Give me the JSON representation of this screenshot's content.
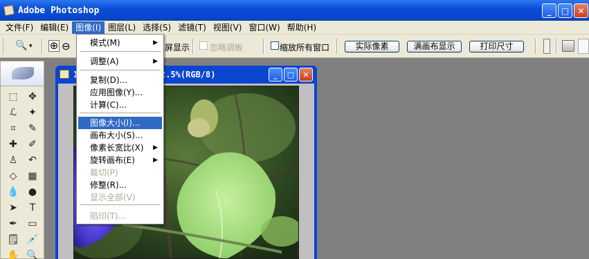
{
  "window": {
    "title": "Adobe Photoshop",
    "controls": {
      "minimize": "_",
      "maximize": "□",
      "close": "✕"
    }
  },
  "menubar": {
    "items": [
      "文件(F)",
      "编辑(E)",
      "图像(I)",
      "图层(L)",
      "选择(S)",
      "滤镜(T)",
      "视图(V)",
      "窗口(W)",
      "帮助(H)"
    ],
    "active_index": 2
  },
  "options_bar": {
    "tool_icon": "zoom-icon",
    "tool_glyph": "🔍",
    "caret": "▾",
    "zoom_in_glyph": "⊕",
    "zoom_out_glyph": "⊖",
    "fit_screen_label": "屏显示",
    "ignore_palettes_label": "忽略调板",
    "zoom_all_windows_label": "缩放所有窗口",
    "actual_pixels_label": "实际像素",
    "fit_on_screen_label": "满画布显示",
    "print_size_label": "打印尺寸"
  },
  "document": {
    "title_suffix": "2.5%(RGB/8)",
    "title_prefix": "1"
  },
  "image_menu": {
    "items": [
      {
        "label": "模式(M)",
        "submenu": true,
        "enabled": true
      },
      {
        "label": "调整(A)",
        "submenu": true,
        "enabled": true
      },
      {
        "label": "复制(D)...",
        "submenu": false,
        "enabled": true
      },
      {
        "label": "应用图像(Y)...",
        "submenu": false,
        "enabled": true
      },
      {
        "label": "计算(C)...",
        "submenu": false,
        "enabled": true
      },
      {
        "label": "图像大小(I)...",
        "submenu": false,
        "enabled": true,
        "highlighted": true
      },
      {
        "label": "画布大小(S)...",
        "submenu": false,
        "enabled": true
      },
      {
        "label": "像素长宽比(X)",
        "submenu": true,
        "enabled": true
      },
      {
        "label": "旋转画布(E)",
        "submenu": true,
        "enabled": true
      },
      {
        "label": "裁切(P)",
        "submenu": false,
        "enabled": false
      },
      {
        "label": "修整(R)...",
        "submenu": false,
        "enabled": true
      },
      {
        "label": "显示全部(V)",
        "submenu": false,
        "enabled": false
      },
      {
        "label": "陷印(T)...",
        "submenu": false,
        "enabled": false
      }
    ],
    "submenu_arrow": "▶"
  },
  "toolbox": {
    "tools": [
      {
        "name": "marquee-tool-icon",
        "glyph": "⬚"
      },
      {
        "name": "move-tool-icon",
        "glyph": "✥"
      },
      {
        "name": "lasso-tool-icon",
        "glyph": "ℒ"
      },
      {
        "name": "magic-wand-tool-icon",
        "glyph": "✦"
      },
      {
        "name": "crop-tool-icon",
        "glyph": "⌗"
      },
      {
        "name": "slice-tool-icon",
        "glyph": "✎"
      },
      {
        "name": "healing-brush-tool-icon",
        "glyph": "✚"
      },
      {
        "name": "brush-tool-icon",
        "glyph": "✐"
      },
      {
        "name": "clone-stamp-tool-icon",
        "glyph": "♙"
      },
      {
        "name": "history-brush-tool-icon",
        "glyph": "↶"
      },
      {
        "name": "eraser-tool-icon",
        "glyph": "◇"
      },
      {
        "name": "gradient-tool-icon",
        "glyph": "▦"
      },
      {
        "name": "blur-tool-icon",
        "glyph": "💧"
      },
      {
        "name": "dodge-tool-icon",
        "glyph": "●"
      },
      {
        "name": "path-selection-tool-icon",
        "glyph": "➤"
      },
      {
        "name": "type-tool-icon",
        "glyph": "T"
      },
      {
        "name": "pen-tool-icon",
        "glyph": "✒"
      },
      {
        "name": "shape-tool-icon",
        "glyph": "▭"
      },
      {
        "name": "notes-tool-icon",
        "glyph": "🗒"
      },
      {
        "name": "eyedropper-tool-icon",
        "glyph": "💉"
      },
      {
        "name": "hand-tool-icon",
        "glyph": "✋"
      },
      {
        "name": "zoom-tool-icon",
        "glyph": "🔍"
      }
    ]
  },
  "colors": {
    "title_blue": "#0a4fd8",
    "menu_highlight": "#316ac5",
    "workspace_gray": "#808080"
  }
}
